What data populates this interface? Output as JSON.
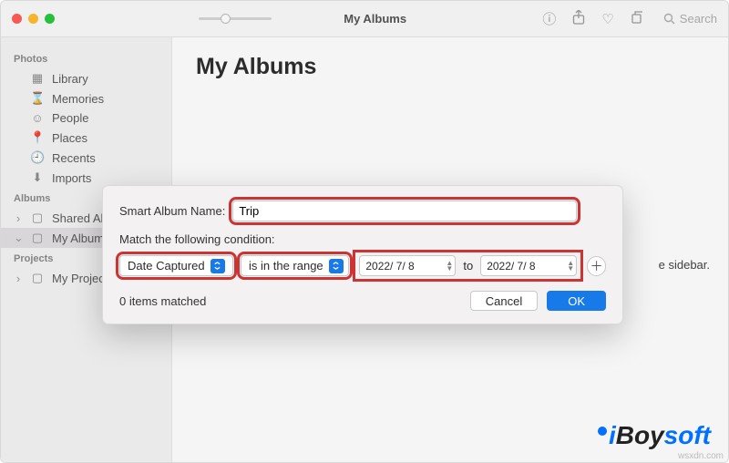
{
  "titlebar": {
    "title": "My Albums",
    "search_placeholder": "Search"
  },
  "sidebar": {
    "sections": [
      {
        "header": "Photos",
        "items": [
          {
            "label": "Library"
          },
          {
            "label": "Memories"
          },
          {
            "label": "People"
          },
          {
            "label": "Places"
          },
          {
            "label": "Recents"
          },
          {
            "label": "Imports"
          }
        ]
      },
      {
        "header": "Albums",
        "items": [
          {
            "label": "Shared Albums",
            "disclosure": true
          },
          {
            "label": "My Albums",
            "disclosure": true,
            "selected": true
          }
        ]
      },
      {
        "header": "Projects",
        "items": [
          {
            "label": "My Projects",
            "disclosure": true
          }
        ]
      }
    ]
  },
  "main": {
    "heading": "My Albums",
    "hint_fragment": "e sidebar."
  },
  "sheet": {
    "name_label": "Smart Album Name:",
    "name_value": "Trip",
    "match_label": "Match the following condition:",
    "field_select": "Date Captured",
    "op_select": "is in the range",
    "date_from": "2022/ 7/ 8",
    "to_label": "to",
    "date_to": "2022/ 7/ 8",
    "matched_text": "0 items matched",
    "cancel": "Cancel",
    "ok": "OK"
  },
  "watermark": {
    "i": "i",
    "boy": "Boy",
    "soft": "soft",
    "domain": "wsxdn.com"
  }
}
